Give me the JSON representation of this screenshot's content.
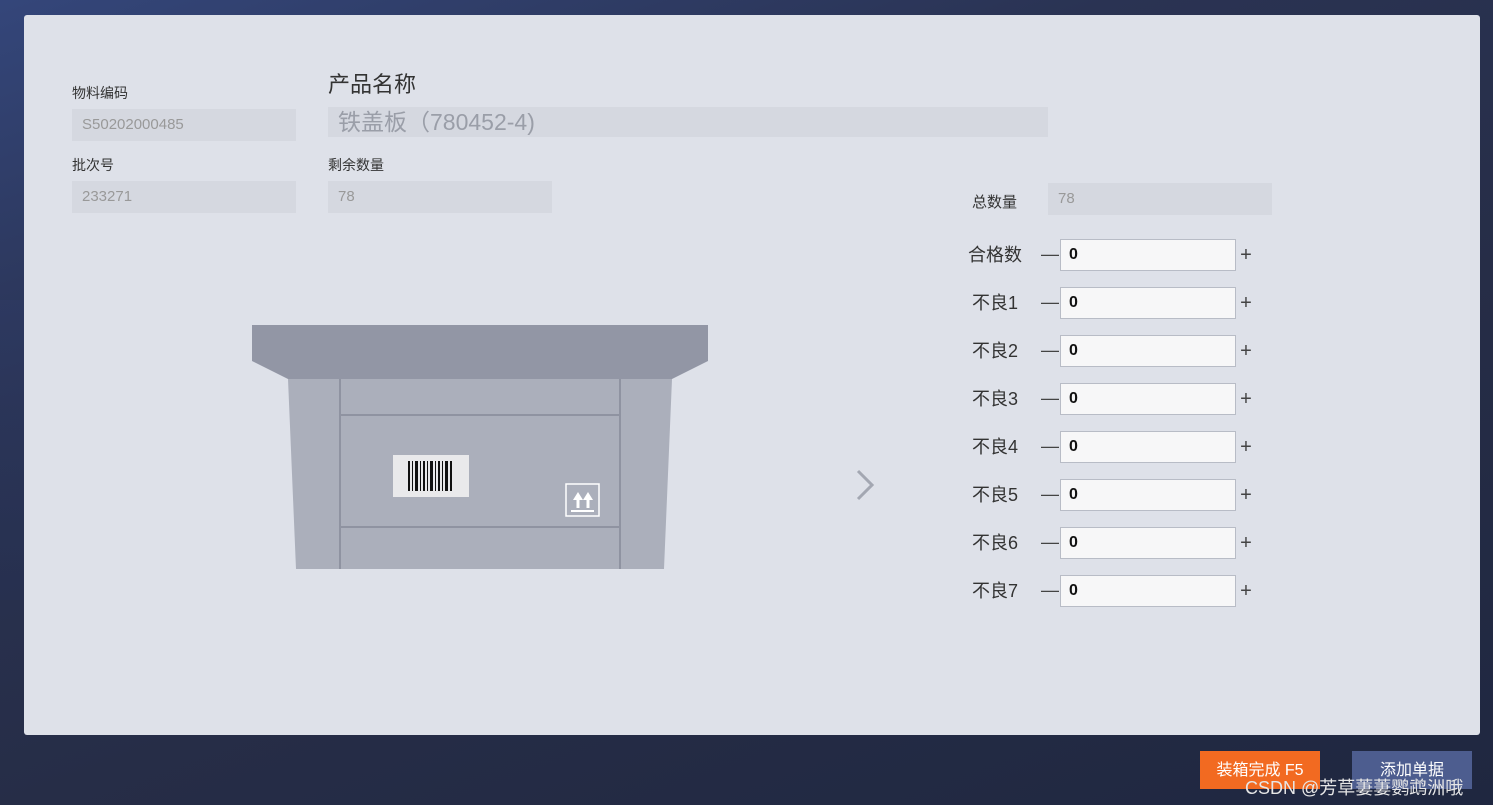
{
  "form": {
    "material_code_label": "物料编码",
    "material_code_value": "S50202000485",
    "product_name_label": "产品名称",
    "product_name_value": "铁盖板（780452-4)",
    "batch_label": "批次号",
    "batch_value": "233271",
    "remaining_label": "剩余数量",
    "remaining_value": "78",
    "total_label": "总数量",
    "total_value": "78"
  },
  "counts": [
    {
      "label": "合格数",
      "value": "0"
    },
    {
      "label": "不良1",
      "value": "0"
    },
    {
      "label": "不良2",
      "value": "0"
    },
    {
      "label": "不良3",
      "value": "0"
    },
    {
      "label": "不良4",
      "value": "0"
    },
    {
      "label": "不良5",
      "value": "0"
    },
    {
      "label": "不良6",
      "value": "0"
    },
    {
      "label": "不良7",
      "value": "0"
    }
  ],
  "controls": {
    "minus": "—",
    "plus": "+"
  },
  "icons": {
    "box": "box-illustration",
    "barcode": "barcode-icon",
    "this_side_up": "this-side-up-icon",
    "next": "chevron-right-icon"
  },
  "buttons": {
    "finish": "装箱完成 F5",
    "add": "添加单据"
  },
  "watermark": "CSDN @芳草萋萋鹦鹉洲哦",
  "colors": {
    "accent_orange": "#f26a21",
    "button_blue": "#4d5d8f",
    "panel": "#dee1e9"
  }
}
